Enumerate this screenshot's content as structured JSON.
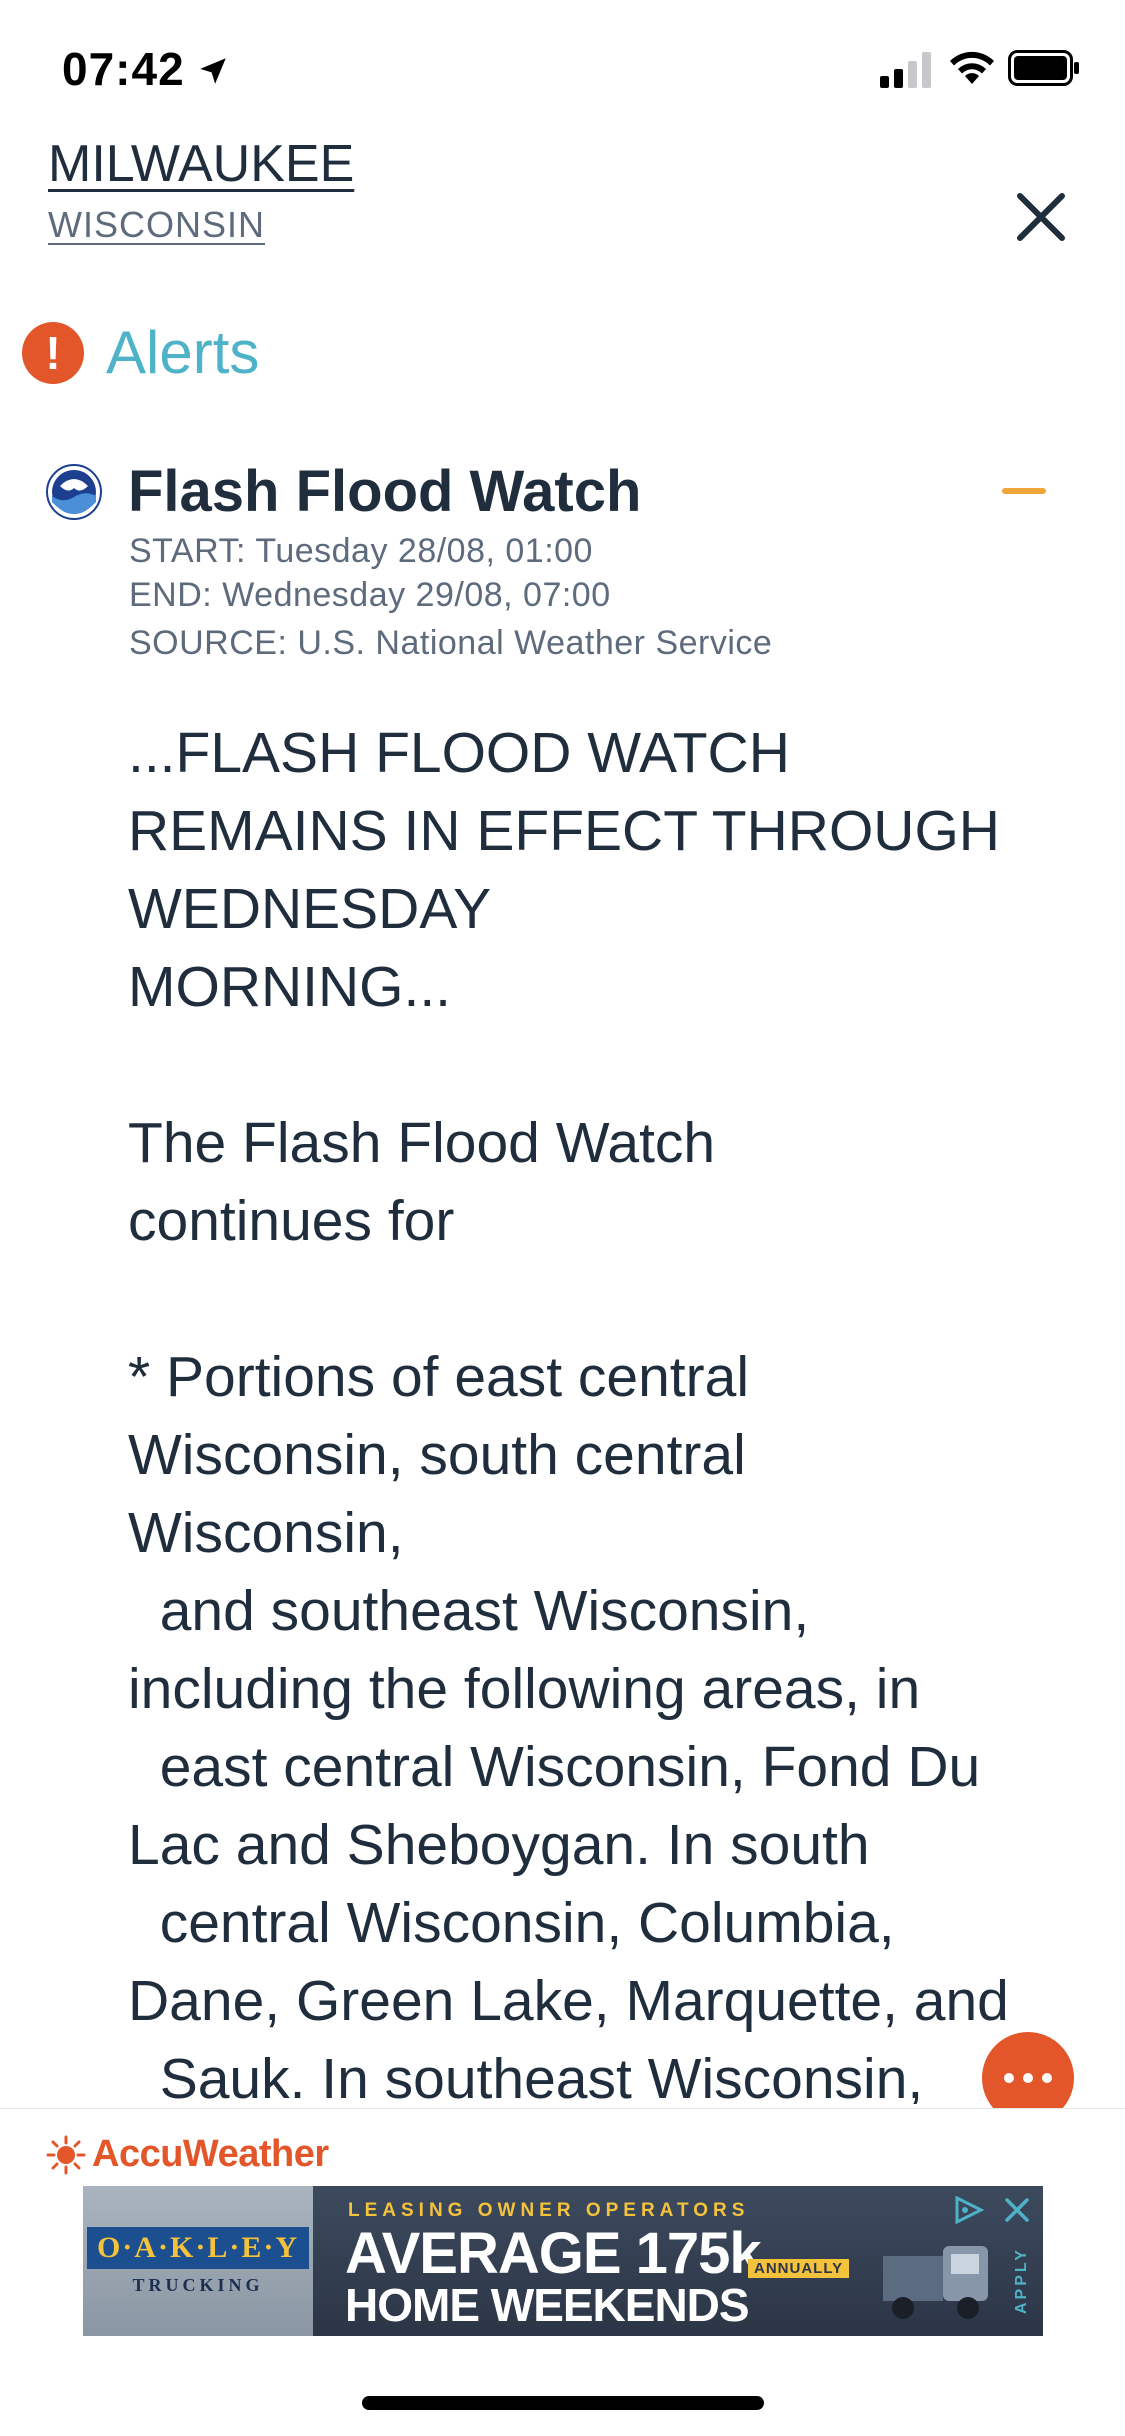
{
  "status_bar": {
    "time": "07:42",
    "icons": [
      "location-arrow-icon",
      "cellular-signal-icon",
      "wifi-icon",
      "battery-icon"
    ]
  },
  "header": {
    "city": "MILWAUKEE",
    "state": "WISCONSIN",
    "close_icon": "close-icon"
  },
  "alerts_section": {
    "icon": "exclamation-icon",
    "title": "Alerts"
  },
  "alert": {
    "source_icon": "noaa-logo-icon",
    "title": "Flash Flood Watch",
    "start": "START: Tuesday 28/08, 01:00",
    "end": "END: Wednesday 29/08, 07:00",
    "source": "SOURCE: U.S. National Weather Service",
    "body_paragraphs": [
      "...FLASH FLOOD WATCH\nREMAINS IN EFFECT THROUGH\nWEDNESDAY\nMORNING...",
      "The Flash Flood Watch\ncontinues for",
      "* Portions of east central\nWisconsin, south central\nWisconsin,\n  and southeast Wisconsin,\nincluding the following areas, in\n  east central Wisconsin, Fond Du\nLac and Sheboygan. In south\n  central Wisconsin, Columbia,\nDane, Green Lake, Marquette, and\n  Sauk. In southeast Wisconsin,"
    ]
  },
  "footer": {
    "brand": "AccuWeather",
    "ad": {
      "brand": "O·A·K·L·E·Y",
      "brand_sub": "TRUCKING",
      "tagline": "LEASING OWNER OPERATORS",
      "headline": "AVERAGE 175k",
      "annual_badge": "ANNUALLY",
      "subheadline": "HOME WEEKENDS",
      "side_text": "APPLY"
    }
  },
  "colors": {
    "accent_orange": "#e2562a",
    "alerts_teal": "#4eb3c8",
    "collapse_yellow": "#f0a63a",
    "text_dark": "#1f2d3d"
  }
}
